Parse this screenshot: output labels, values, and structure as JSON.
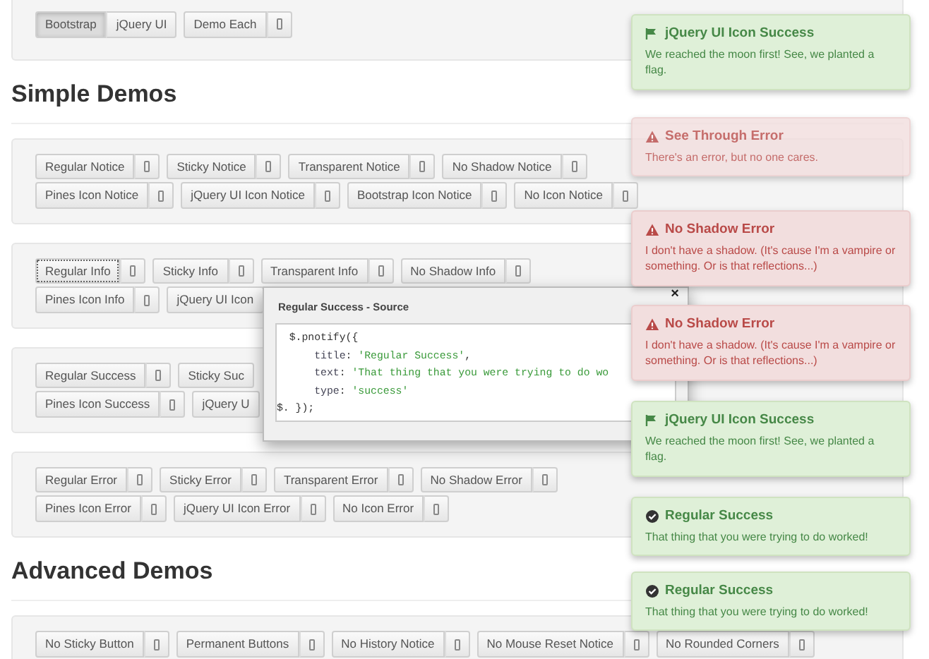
{
  "style_toggle": [
    {
      "label": "Bootstrap",
      "selected": true
    },
    {
      "label": "jQuery UI",
      "selected": false
    }
  ],
  "demo_each": {
    "label": "Demo Each",
    "source": true
  },
  "sections": [
    {
      "heading": "Simple Demos",
      "panels": [
        {
          "rows": [
            [
              {
                "label": "Regular Notice",
                "source": true
              },
              {
                "label": "Sticky Notice",
                "source": true
              },
              {
                "label": "Transparent Notice",
                "source": true
              },
              {
                "label": "No Shadow Notice",
                "source": true
              }
            ],
            [
              {
                "label": "Pines Icon Notice",
                "source": true
              },
              {
                "label": "jQuery UI Icon Notice",
                "source": true
              },
              {
                "label": "Bootstrap Icon Notice",
                "source": true
              },
              {
                "label": "No Icon Notice",
                "source": true
              }
            ]
          ]
        },
        {
          "rows": [
            [
              {
                "label": "Regular Info",
                "source": true,
                "focused": true
              },
              {
                "label": "Sticky Info",
                "source": true
              },
              {
                "label": "Transparent Info",
                "source": true
              },
              {
                "label": "No Shadow Info",
                "source": true
              }
            ],
            [
              {
                "label": "Pines Icon Info",
                "source": true
              },
              {
                "label": "jQuery UI Icon",
                "source": false
              }
            ]
          ]
        },
        {
          "rows": [
            [
              {
                "label": "Regular Success",
                "source": true
              },
              {
                "label": "Sticky Suc",
                "source": false
              }
            ],
            [
              {
                "label": "Pines Icon Success",
                "source": true
              },
              {
                "label": "jQuery U",
                "source": false
              }
            ]
          ]
        },
        {
          "rows": [
            [
              {
                "label": "Regular Error",
                "source": true
              },
              {
                "label": "Sticky Error",
                "source": true
              },
              {
                "label": "Transparent Error",
                "source": true
              },
              {
                "label": "No Shadow Error",
                "source": true
              }
            ],
            [
              {
                "label": "Pines Icon Error",
                "source": true
              },
              {
                "label": "jQuery UI Icon Error",
                "source": true
              },
              {
                "label": "No Icon Error",
                "source": true
              }
            ]
          ]
        }
      ]
    },
    {
      "heading": "Advanced Demos",
      "panels": [
        {
          "rows": [
            [
              {
                "label": "No Sticky Button",
                "source": true
              },
              {
                "label": "Permanent Buttons",
                "source": true
              },
              {
                "label": "No History Notice",
                "source": true
              },
              {
                "label": "No Mouse Reset Notice",
                "source": true
              },
              {
                "label": "No Rounded Corners",
                "source": true
              }
            ]
          ]
        }
      ]
    }
  ],
  "source_dialog": {
    "title": "Regular Success - Source",
    "close": "×",
    "lines": [
      [
        {
          "kind": "plain",
          "text": "  $.pnotify({"
        }
      ],
      [
        {
          "kind": "key",
          "text": "      title"
        },
        {
          "kind": "plain",
          "text": ": "
        },
        {
          "kind": "string",
          "text": "'Regular Success'"
        },
        {
          "kind": "plain",
          "text": ","
        }
      ],
      [
        {
          "kind": "key",
          "text": "      text"
        },
        {
          "kind": "plain",
          "text": ": "
        },
        {
          "kind": "string",
          "text": "'That thing that you were trying to do wo"
        }
      ],
      [
        {
          "kind": "key",
          "text": "      type"
        },
        {
          "kind": "plain",
          "text": ": "
        },
        {
          "kind": "string",
          "text": "'success'"
        }
      ],
      [
        {
          "kind": "plain",
          "text": "$. });"
        }
      ]
    ]
  },
  "notices": [
    {
      "kind": "flag",
      "translucent": false,
      "title": "jQuery UI Icon Success",
      "text": "We reached the moon first! See, we planted a flag."
    },
    {
      "kind": "warning",
      "translucent": true,
      "title": "See Through Error",
      "text": "There's an error, but no one cares."
    },
    {
      "kind": "warning",
      "translucent": false,
      "title": "No Shadow Error",
      "text": "I don't have a shadow. (It's cause I'm a vampire or something. Or is that reflections...)"
    },
    {
      "kind": "warning",
      "translucent": false,
      "title": "No Shadow Error",
      "text": "I don't have a shadow. (It's cause I'm a vampire or something. Or is that reflections...)"
    },
    {
      "kind": "flag",
      "translucent": false,
      "title": "jQuery UI Icon Success",
      "text": "We reached the moon first! See, we planted a flag."
    },
    {
      "kind": "check",
      "translucent": false,
      "title": "Regular Success",
      "text": "That thing that you were trying to do worked!"
    },
    {
      "kind": "check",
      "translucent": false,
      "title": "Regular Success",
      "text": "That thing that you were trying to do worked!"
    }
  ]
}
